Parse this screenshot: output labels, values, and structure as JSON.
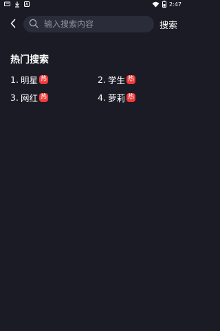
{
  "status_bar": {
    "time": "2:47",
    "icons": [
      "notification-icon",
      "download-icon",
      "app-icon",
      "wifi-icon",
      "battery-icon"
    ]
  },
  "search": {
    "placeholder": "输入搜索内容",
    "value": "",
    "action_label": "搜索"
  },
  "hot_section": {
    "title": "热门搜索",
    "badge_text": "热",
    "items": [
      {
        "rank": "1.",
        "label": "明星"
      },
      {
        "rank": "2.",
        "label": "学生"
      },
      {
        "rank": "3.",
        "label": "网红"
      },
      {
        "rank": "4.",
        "label": "萝莉"
      }
    ]
  },
  "colors": {
    "background": "#1a1b25",
    "search_box": "#2a2c39",
    "hot_badge": "#f03a3a",
    "placeholder": "#8f929e"
  }
}
